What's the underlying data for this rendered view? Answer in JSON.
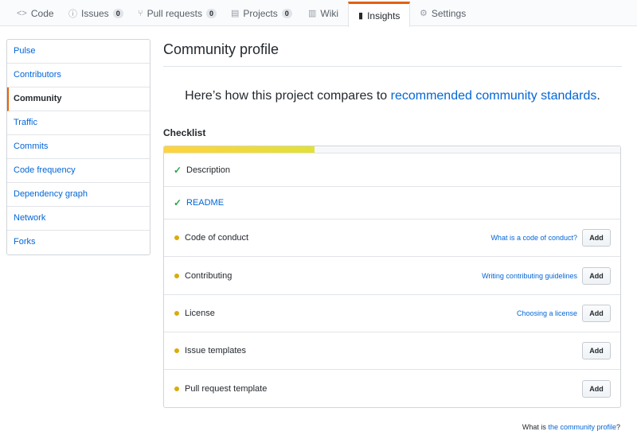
{
  "nav": {
    "tabs": [
      {
        "icon": "code-icon",
        "glyph": "<>",
        "label": "Code",
        "count": ""
      },
      {
        "icon": "issue-icon",
        "glyph": "ⓘ",
        "label": "Issues",
        "count": "0"
      },
      {
        "icon": "pull-request-icon",
        "glyph": "⑂",
        "label": "Pull requests",
        "count": "0"
      },
      {
        "icon": "project-icon",
        "glyph": "▤",
        "label": "Projects",
        "count": "0"
      },
      {
        "icon": "wiki-icon",
        "glyph": "▥",
        "label": "Wiki",
        "count": ""
      },
      {
        "icon": "graph-icon",
        "glyph": "▮",
        "label": "Insights",
        "count": "",
        "selected": true
      },
      {
        "icon": "gear-icon",
        "glyph": "⚙",
        "label": "Settings",
        "count": ""
      }
    ]
  },
  "sidebar": {
    "items": [
      {
        "label": "Pulse"
      },
      {
        "label": "Contributors"
      },
      {
        "label": "Community",
        "selected": true
      },
      {
        "label": "Traffic"
      },
      {
        "label": "Commits"
      },
      {
        "label": "Code frequency"
      },
      {
        "label": "Dependency graph"
      },
      {
        "label": "Network"
      },
      {
        "label": "Forks"
      }
    ]
  },
  "main": {
    "title": "Community profile",
    "lead_prefix": "Here’s how this project compares to ",
    "lead_link": "recommended community standards",
    "lead_suffix": ".",
    "checklist_title": "Checklist",
    "progress_fraction": 0.33,
    "items": [
      {
        "label": "Description",
        "status": "done",
        "link_style": false,
        "help": "",
        "action": ""
      },
      {
        "label": "README",
        "status": "done",
        "link_style": true,
        "help": "",
        "action": ""
      },
      {
        "label": "Code of conduct",
        "status": "missing",
        "link_style": false,
        "help": "What is a code of conduct?",
        "action": "Add"
      },
      {
        "label": "Contributing",
        "status": "missing",
        "link_style": false,
        "help": "Writing contributing guidelines",
        "action": "Add"
      },
      {
        "label": "License",
        "status": "missing",
        "link_style": false,
        "help": "Choosing a license",
        "action": "Add"
      },
      {
        "label": "Issue templates",
        "status": "missing",
        "link_style": false,
        "help": "",
        "action": "Add"
      },
      {
        "label": "Pull request template",
        "status": "missing",
        "link_style": false,
        "help": "",
        "action": "Add"
      }
    ],
    "footer_prefix": "What is ",
    "footer_link": "the community profile",
    "footer_suffix": "?"
  },
  "colors": {
    "accent": "#e36209",
    "link": "#0366d6",
    "check": "#28a745",
    "pending_dot": "#dbab09",
    "progress": "#ffd33d"
  }
}
